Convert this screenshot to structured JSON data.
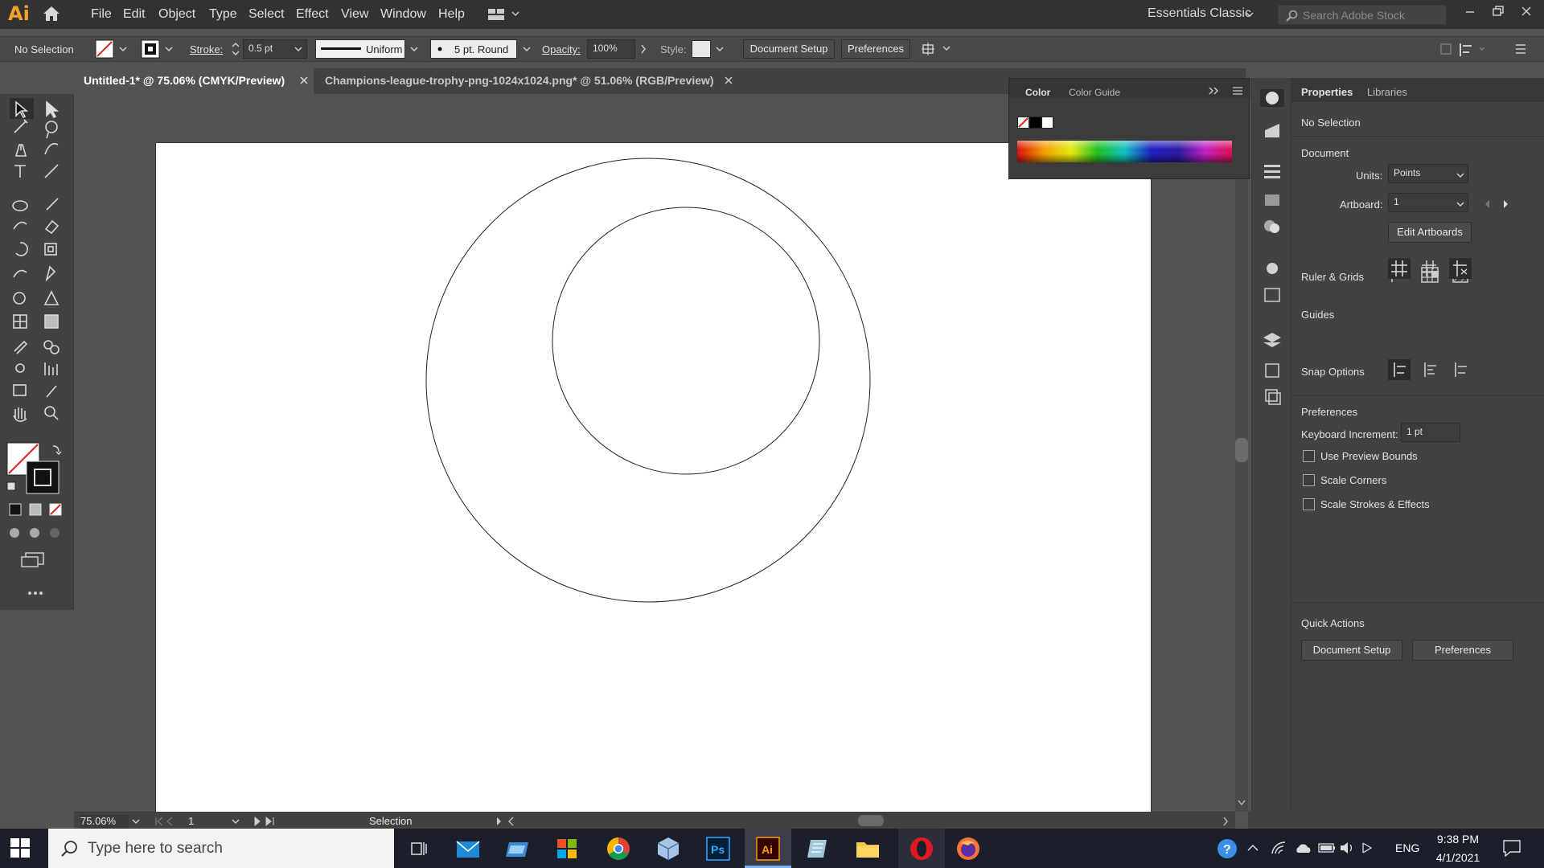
{
  "app": {
    "logo": "Ai"
  },
  "menu": [
    "File",
    "Edit",
    "Object",
    "Type",
    "Select",
    "Effect",
    "View",
    "Window",
    "Help"
  ],
  "workspace": "Essentials Classic",
  "search_placeholder": "Search Adobe Stock",
  "control": {
    "selection": "No Selection",
    "stroke_label": "Stroke:",
    "stroke_value": "0.5 pt",
    "profile": "Uniform",
    "brush": "5 pt. Round",
    "opacity_label": "Opacity:",
    "opacity_value": "100%",
    "style_label": "Style:",
    "doc_setup": "Document Setup",
    "preferences": "Preferences"
  },
  "tabs": [
    {
      "label": "Untitled-1* @ 75.06% (CMYK/Preview)",
      "active": true
    },
    {
      "label": "Champions-league-trophy-png-1024x1024.png* @ 51.06% (RGB/Preview)",
      "active": false
    }
  ],
  "color_panel": {
    "tab1": "Color",
    "tab2": "Color Guide"
  },
  "properties": {
    "tab1": "Properties",
    "tab2": "Libraries",
    "selection": "No Selection",
    "document": "Document",
    "units_label": "Units:",
    "units_value": "Points",
    "artboard_label": "Artboard:",
    "artboard_value": "1",
    "edit_artboards": "Edit Artboards",
    "ruler_grids": "Ruler & Grids",
    "guides": "Guides",
    "snap_options": "Snap Options",
    "preferences": "Preferences",
    "keyboard_increment_label": "Keyboard Increment:",
    "keyboard_increment_value": "1 pt",
    "use_preview_bounds": "Use Preview Bounds",
    "scale_corners": "Scale Corners",
    "scale_strokes": "Scale Strokes & Effects",
    "quick_actions": "Quick Actions",
    "doc_setup": "Document Setup",
    "pref_button": "Preferences"
  },
  "status": {
    "zoom": "75.06%",
    "artboard": "1",
    "tool": "Selection"
  },
  "taskbar": {
    "search": "Type here to search",
    "lang": "ENG",
    "time": "9:38 PM",
    "date": "4/1/2021"
  },
  "colors": {
    "accent_ai": "#f7a128",
    "ps": "#31a8ff",
    "taskbar": "#1b1f2c"
  }
}
